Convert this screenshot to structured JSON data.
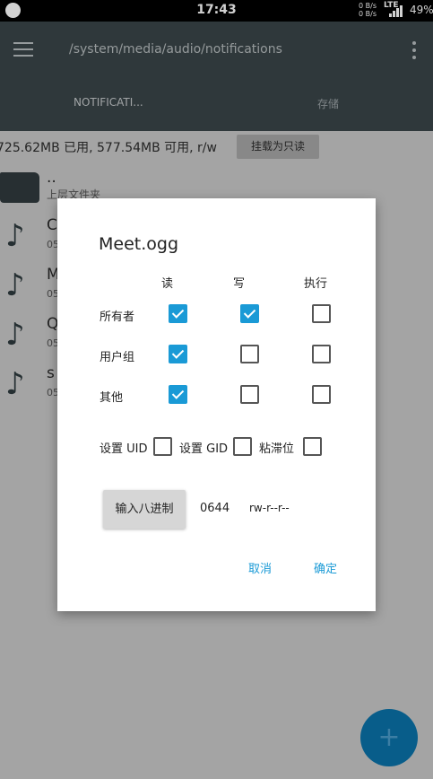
{
  "status_bar": {
    "time": "17:43",
    "net_up": "0 B/s",
    "net_down": "0 B/s",
    "network_type": "LTE",
    "battery": "49%"
  },
  "toolbar": {
    "path": "/system/media/audio/notifications",
    "tabs": [
      "NOTIFICATI...",
      "存储"
    ]
  },
  "storage": {
    "info": "725.62MB 已用, 577.54MB 可用, r/w",
    "mount_button": "挂载为只读"
  },
  "files": [
    {
      "name": "..",
      "sub": "上层文件夹"
    },
    {
      "name": "C",
      "sub": "05"
    },
    {
      "name": "M",
      "sub": "05"
    },
    {
      "name": "Q",
      "sub": "05"
    },
    {
      "name": "s",
      "sub": "05"
    }
  ],
  "dialog": {
    "title": "Meet.ogg",
    "columns": [
      "读",
      "写",
      "执行"
    ],
    "rows": [
      {
        "label": "所有者",
        "read": true,
        "write": true,
        "exec": false
      },
      {
        "label": "用户组",
        "read": true,
        "write": false,
        "exec": false
      },
      {
        "label": "其他",
        "read": true,
        "write": false,
        "exec": false
      }
    ],
    "flags": [
      {
        "label": "设置 UID",
        "checked": false
      },
      {
        "label": "设置 GID",
        "checked": false
      },
      {
        "label": "粘滞位",
        "checked": false
      }
    ],
    "octal_button": "输入八进制",
    "octal_value": "0644",
    "perm_string": "rw-r--r--",
    "cancel": "取消",
    "ok": "确定"
  },
  "fab": {
    "icon": "plus-icon",
    "label": "+"
  },
  "colors": {
    "accent": "#1a9ad6",
    "toolbar": "#3a4549",
    "fab": "#0a72a9"
  }
}
